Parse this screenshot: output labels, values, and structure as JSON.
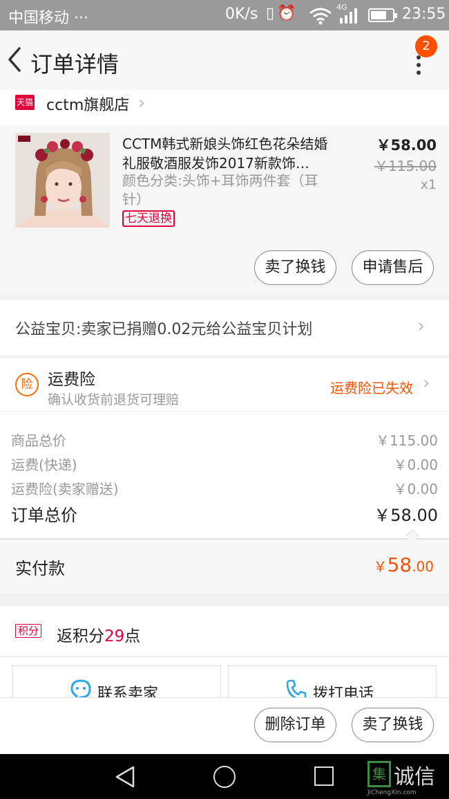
{
  "status_bar": {
    "carrier": "中国移动 ···",
    "speed": "0K/s",
    "network": "4G",
    "time": "23:55"
  },
  "nav": {
    "title": "订单详情",
    "badge_count": "2"
  },
  "store": {
    "platform_tag": "天猫",
    "name": "cctm旗舰店"
  },
  "product": {
    "title": "CCTM韩式新娘头饰红色花朵结婚礼服敬酒服发饰2017新款饰…",
    "sku": "颜色分类:头饰+耳饰两件套（耳针）",
    "tag": "七天退换",
    "price": "￥58.00",
    "original_price": "￥115.00",
    "quantity": "x1",
    "buttons": {
      "resell": "卖了换钱",
      "after_sale": "申请售后"
    }
  },
  "charity": {
    "text": "公益宝贝:卖家已捐赠0.02元给公益宝贝计划"
  },
  "insurance": {
    "icon_char": "险",
    "title": "运费险",
    "subtitle": "确认收货前退货可理赔",
    "status": "运费险已失效",
    "status_color": "#ff5000"
  },
  "summary": {
    "rows": [
      {
        "label": "商品总价",
        "value": "￥115.00"
      },
      {
        "label": "运费(快递)",
        "value": "￥0.00"
      },
      {
        "label": "运费险(卖家赠送)",
        "value": "￥0.00"
      }
    ],
    "total_label": "订单总价",
    "total_value": "￥58.00"
  },
  "paid": {
    "label": "实付款",
    "symbol": "￥",
    "integer": "58",
    "decimal": ".00",
    "color": "#ff5000"
  },
  "points": {
    "tag": "积分",
    "prefix": "返积分",
    "amount": "29",
    "suffix": "点"
  },
  "contacts": {
    "seller": "联系卖家",
    "phone": "拨打电话"
  },
  "actions": {
    "delete": "删除订单",
    "resell": "卖了换钱"
  },
  "watermark": {
    "logo_char": "集",
    "brand": "诚信",
    "site": "JiChengXin.com"
  }
}
